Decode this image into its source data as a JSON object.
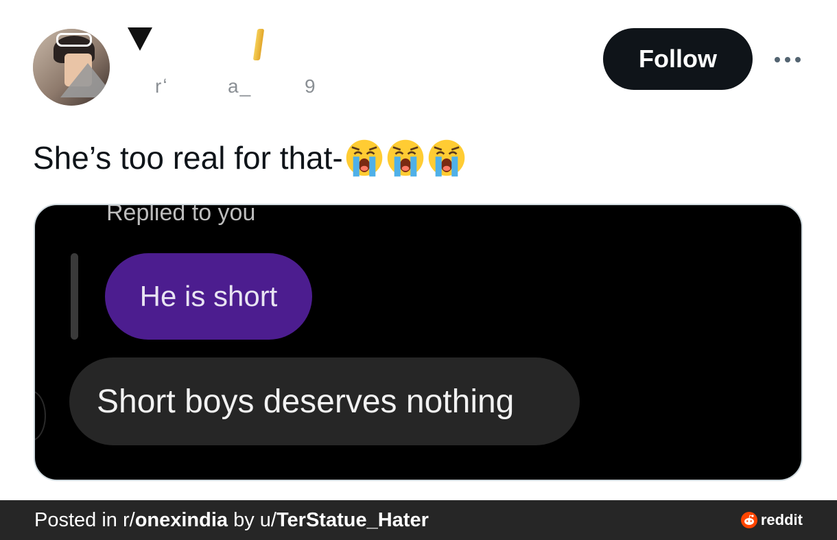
{
  "header": {
    "follow_label": "Follow",
    "handle_fragments": [
      "rʻ",
      "a_",
      "9"
    ]
  },
  "tweet": {
    "text": "She’s too real for that-",
    "emojis": [
      "loudly-crying-face",
      "loudly-crying-face",
      "loudly-crying-face"
    ]
  },
  "media": {
    "replied_label": "Replied to you",
    "quoted_message": "He is short",
    "reply_message": "Short boys deserves nothing",
    "colors": {
      "quoted_bubble": "#4c1d8f",
      "reply_bubble": "#262626",
      "background": "#000000"
    }
  },
  "footer": {
    "posted_in_prefix": "Posted in r/",
    "subreddit": "onexindia",
    "by_prefix": " by u/",
    "username": "TerStatue_Hater",
    "brand": "reddit",
    "brand_color": "#ff4500"
  }
}
